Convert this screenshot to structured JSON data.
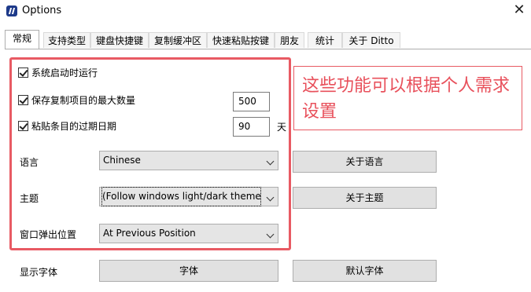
{
  "window": {
    "title": "Options",
    "close_glyph": "✕",
    "icon": "ditto-app-icon"
  },
  "tabs": [
    {
      "label": "常规",
      "active": true
    },
    {
      "label": "支持类型"
    },
    {
      "label": "键盘快捷键"
    },
    {
      "label": "复制缓冲区"
    },
    {
      "label": "快速粘贴按键"
    },
    {
      "label": "朋友"
    },
    {
      "label": "统计"
    },
    {
      "label": "关于 Ditto"
    }
  ],
  "general": {
    "startup_label": "系统启动时运行",
    "max_items_label": "保存复制项目的最大数量",
    "max_items_value": "500",
    "expire_label": "粘贴条目的过期日期",
    "expire_value": "90",
    "expire_unit": "天",
    "language_label": "语言",
    "language_value": "Chinese",
    "about_language_button": "关于语言",
    "theme_label": "主题",
    "theme_value": "(Follow windows light/dark themes",
    "about_theme_button": "关于主题",
    "popup_label": "窗口弹出位置",
    "popup_value": "At Previous Position",
    "font_label": "显示字体",
    "font_button": "字体",
    "default_font_button": "默认字体"
  },
  "annotation": {
    "text": "这些功能可以根据个人需求设置",
    "color": "#e8505b"
  }
}
